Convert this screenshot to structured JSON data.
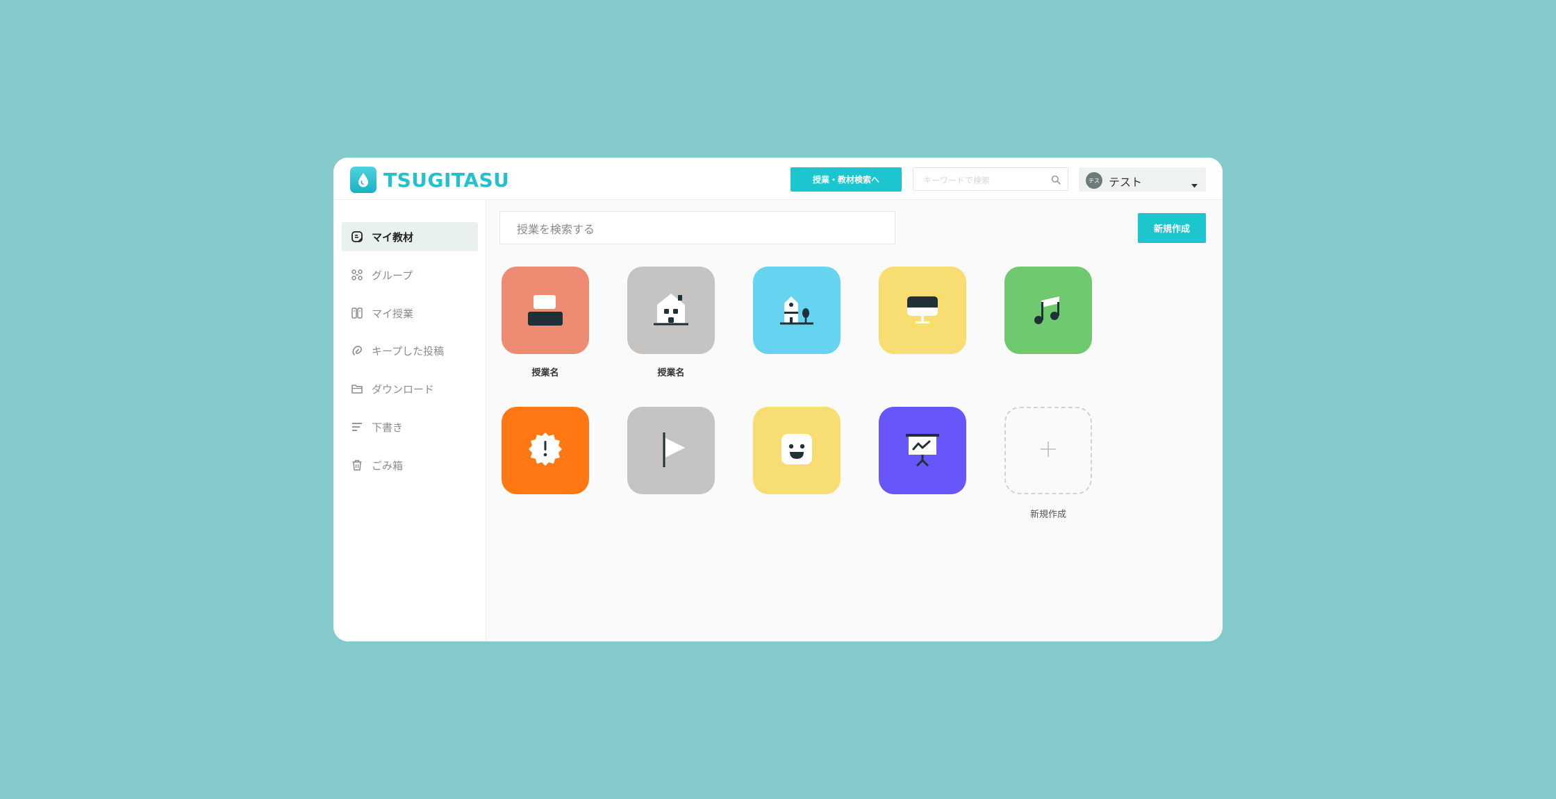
{
  "app": {
    "logo_text": "TSUGITASU"
  },
  "header": {
    "search_materials_button": "授業・教材検索へ",
    "keyword_placeholder": "キーワードで検索",
    "user": {
      "avatar_text": "テス",
      "name": "テスト"
    }
  },
  "sidebar": {
    "items": [
      {
        "label": "マイ教材",
        "icon": "document-icon",
        "active": true
      },
      {
        "label": "グループ",
        "icon": "group-icon"
      },
      {
        "label": "マイ授業",
        "icon": "lesson-icon"
      },
      {
        "label": "キープした投稿",
        "icon": "clip-icon"
      },
      {
        "label": "ダウンロード",
        "icon": "folder-icon"
      },
      {
        "label": "下書き",
        "icon": "lines-icon"
      },
      {
        "label": "ごみ箱",
        "icon": "trash-icon"
      }
    ]
  },
  "main": {
    "search_placeholder": "授業を検索する",
    "new_button": "新規作成",
    "tiles": [
      {
        "label": "授業名",
        "icon": "blocks-icon",
        "color": "#ee8c73"
      },
      {
        "label": "授業名",
        "icon": "house-icon",
        "color": "#c6c4c3"
      },
      {
        "label": "",
        "icon": "building-tree-icon",
        "color": "#66d4f0"
      },
      {
        "label": "",
        "icon": "monitor-icon",
        "color": "#f8de72"
      },
      {
        "label": "",
        "icon": "music-note-icon",
        "color": "#6ec96f"
      },
      {
        "label": "",
        "icon": "alert-badge-icon",
        "color": "#ff7814"
      },
      {
        "label": "",
        "icon": "flag-icon",
        "color": "#c6c4c3"
      },
      {
        "label": "",
        "icon": "smile-icon",
        "color": "#f8de72"
      },
      {
        "label": "",
        "icon": "presentation-icon",
        "color": "#6757fb"
      }
    ],
    "new_tile_label": "新規作成"
  }
}
